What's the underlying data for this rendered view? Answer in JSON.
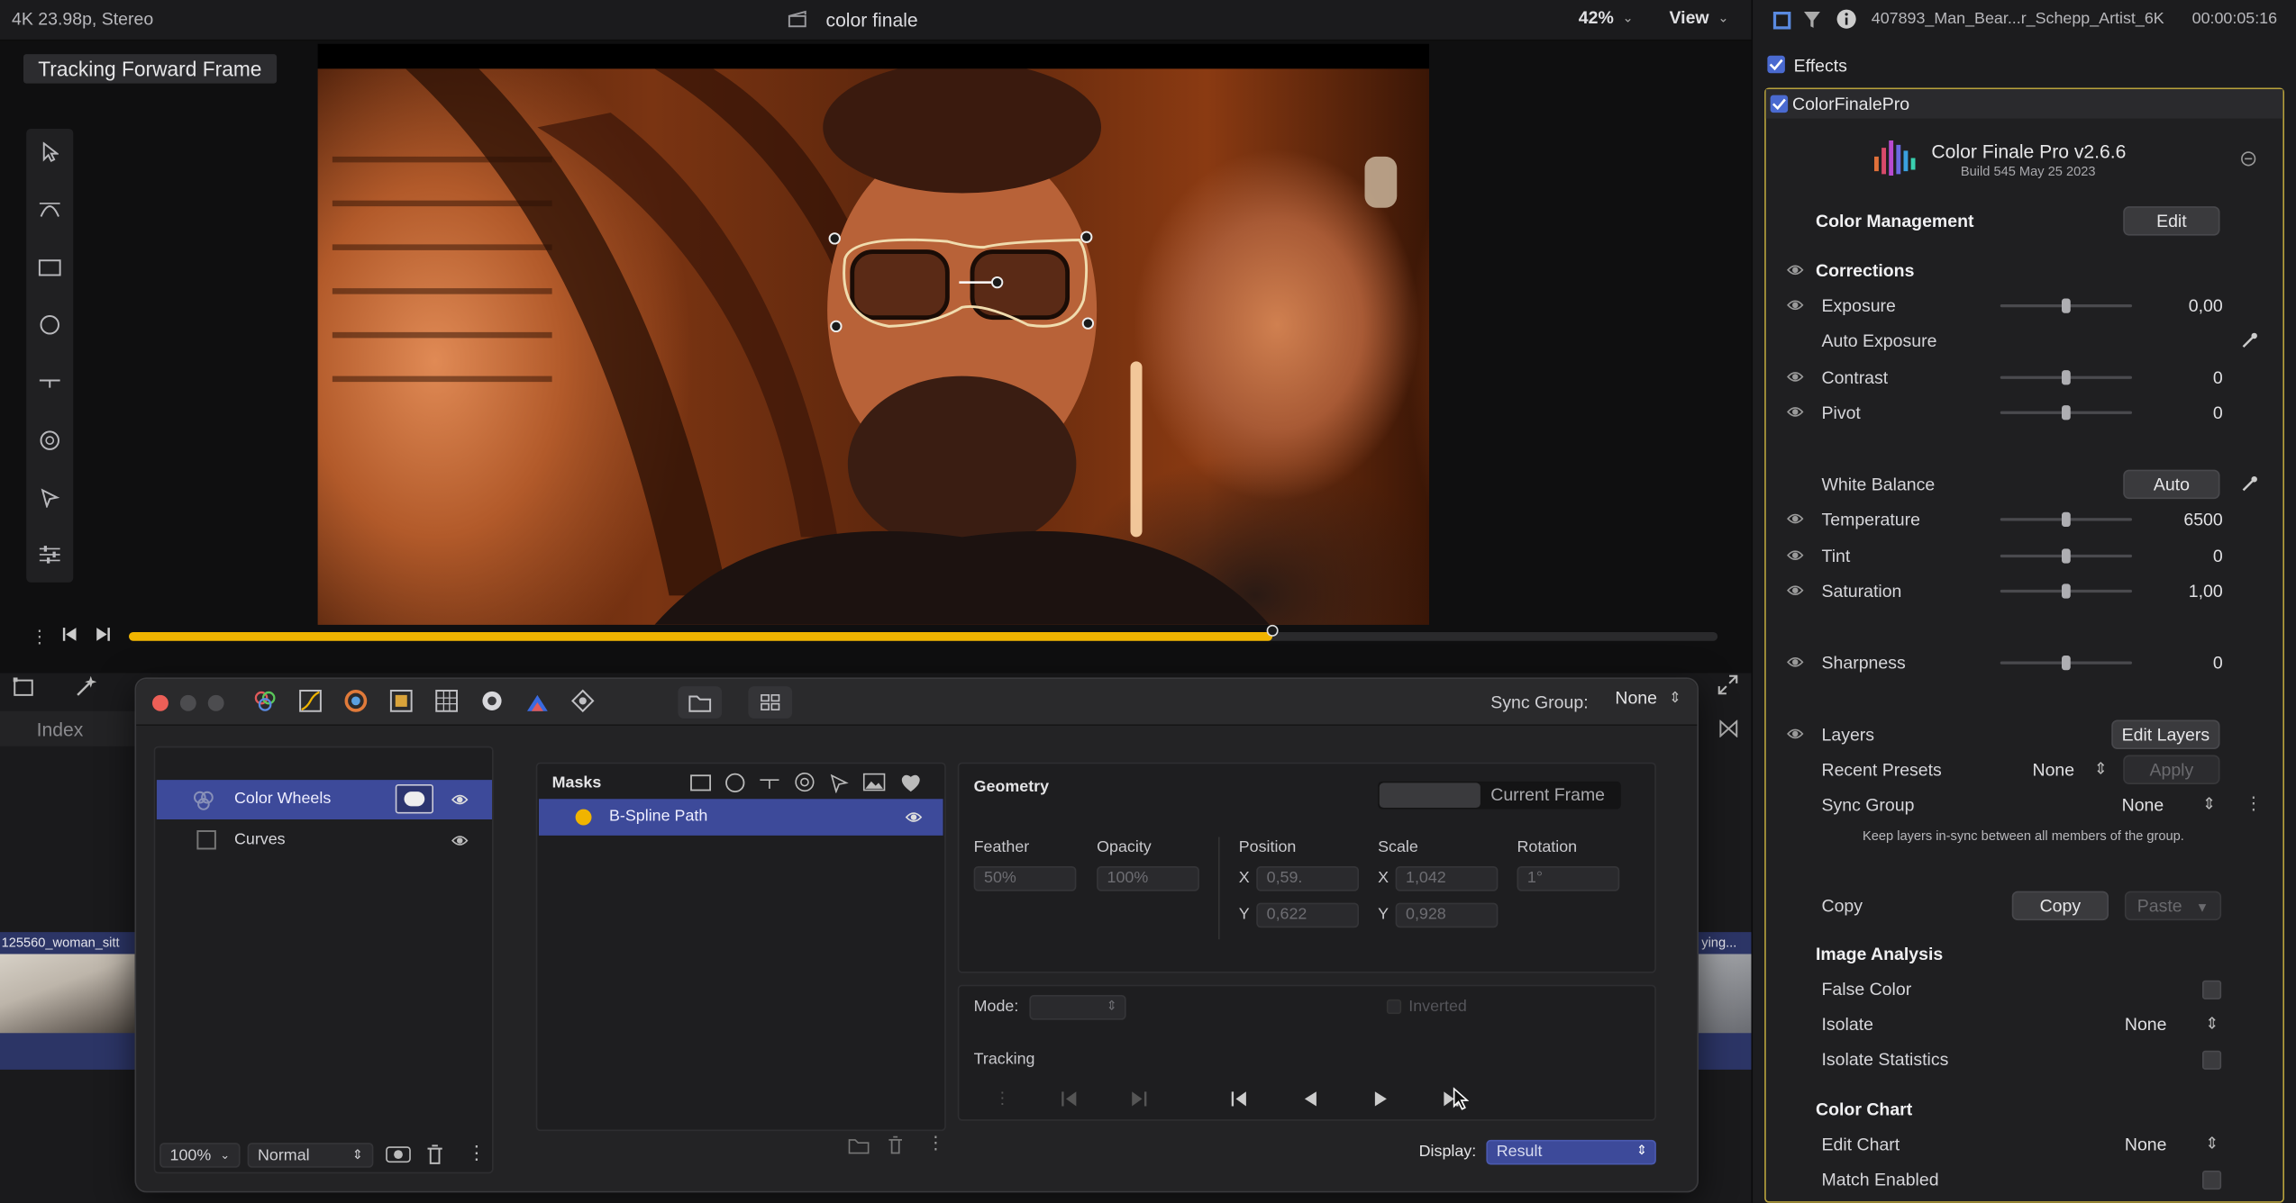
{
  "topbar": {
    "format": "4K 23.98p, Stereo",
    "title": "color finale",
    "zoom": "42%",
    "view": "View"
  },
  "viewer": {
    "tracking_badge": "Tracking Forward Frame"
  },
  "timeline": {
    "index_label": "Index",
    "clip_left": "125560_woman_sitt",
    "clip_right": "ying..."
  },
  "cf": {
    "sync_group_label": "Sync Group:",
    "sync_group_value": "None",
    "layers": [
      {
        "name": "Color Wheels",
        "selected": true
      },
      {
        "name": "Curves",
        "selected": false
      }
    ],
    "layer_opacity": "100%",
    "blend_mode": "Normal",
    "masks_title": "Masks",
    "mask_item": "B-Spline Path",
    "geometry": {
      "title": "Geometry",
      "seg_current": "Current Frame",
      "feather_label": "Feather",
      "feather": "50%",
      "opacity_label": "Opacity",
      "opacity": "100%",
      "position_label": "Position",
      "pos_x": "0,59.",
      "pos_y": "0,622",
      "scale_label": "Scale",
      "scale_x": "1,042",
      "scale_y": "0,928",
      "rotation_label": "Rotation",
      "rotation": "1°",
      "x": "X",
      "y": "Y"
    },
    "mode_label": "Mode:",
    "inverted_label": "Inverted",
    "tracking_label": "Tracking",
    "display_label": "Display:",
    "display_value": "Result"
  },
  "inspector": {
    "clip_name": "407893_Man_Bear...r_Schepp_Artist_6K",
    "clip_tc": "00:00:05:16",
    "effects_label": "Effects",
    "plugin_name": "ColorFinalePro",
    "product_title": "Color Finale Pro v2.6.6",
    "product_build": "Build 545 May 25 2023",
    "color_management": "Color Management",
    "edit_btn": "Edit",
    "corrections": "Corrections",
    "exposure": "Exposure",
    "exposure_val": "0,00",
    "auto_exposure": "Auto Exposure",
    "contrast": "Contrast",
    "contrast_val": "0",
    "pivot": "Pivot",
    "pivot_val": "0",
    "white_balance": "White Balance",
    "auto_btn": "Auto",
    "temperature": "Temperature",
    "temperature_val": "6500",
    "tint": "Tint",
    "tint_val": "0",
    "saturation": "Saturation",
    "saturation_val": "1,00",
    "sharpness": "Sharpness",
    "sharpness_val": "0",
    "layers": "Layers",
    "edit_layers_btn": "Edit Layers",
    "recent_presets": "Recent Presets",
    "recent_presets_val": "None",
    "apply_btn": "Apply",
    "sync_group": "Sync Group",
    "sync_group_val": "None",
    "sync_note": "Keep layers in-sync between all members of the group.",
    "copy_label": "Copy",
    "copy_btn": "Copy",
    "paste_btn": "Paste",
    "image_analysis": "Image Analysis",
    "false_color": "False Color",
    "isolate": "Isolate",
    "isolate_val": "None",
    "isolate_stats": "Isolate Statistics",
    "color_chart": "Color Chart",
    "edit_chart": "Edit Chart",
    "edit_chart_val": "None",
    "match_enabled": "Match Enabled"
  },
  "colors": {
    "accent_yellow": "#f0b400",
    "selection_blue": "#3d4a9a",
    "plugin_border": "#b8a23c"
  },
  "playback_progress": 0.72
}
